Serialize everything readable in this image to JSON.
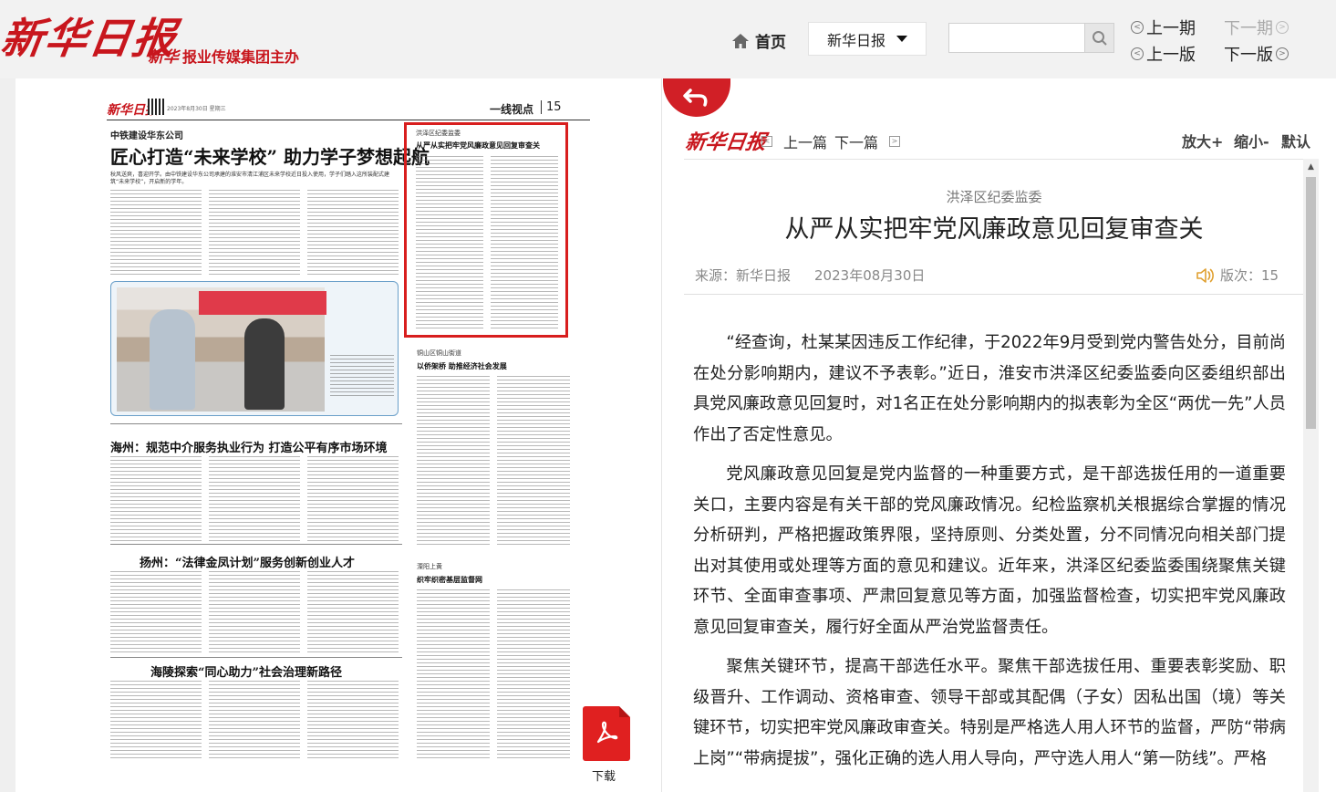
{
  "header": {
    "logo": "新华日报",
    "host_mark": "新华",
    "host_text": "报业传媒集团主办",
    "home": "首页",
    "paper_select": "新华日报",
    "search": {
      "value": "",
      "placeholder": ""
    },
    "prev_issue": "上一期",
    "next_issue": "下一期",
    "prev_page": "上一版",
    "next_page": "下一版"
  },
  "newspaper": {
    "logo": "新华日报",
    "date": "2023年8月30日  星期三",
    "section": "一线视点",
    "page_number": "15",
    "lead_kicker": "中铁建设华东公司",
    "lead_headline": "匠心打造“未来学校” 助力学子梦想起航",
    "lead_sub": "秋风送爽，喜迎开学。由中铁建设华东公司承建的淮安市清江浦区未来学校近日投入使用，学子们踏入这所装配式建筑“未来学校”，开启新的学年。",
    "boxed_kicker": "洪泽区纪委监委",
    "boxed_title": "从严从实把牢党风廉政意见回复审查关",
    "story2_kicker": "铜山区铜山街道",
    "story2_title": "以侨架桥 助推经济社会发展",
    "story3_title": "海州：规范中介服务执业行为 打造公平有序市场环境",
    "story4_kicker": "溧阳上黄",
    "story4_title": "织牢织密基层监督网",
    "story5_title": "扬州：“法律金凤计划”服务创新创业人才",
    "story6_title": "海陵探索“同心助力”社会治理新路径",
    "download_label": "下载"
  },
  "article_nav": {
    "logo": "新华日报",
    "prev_article": "上一篇",
    "next_article": "下一篇",
    "zoom_in": "放大+",
    "zoom_out": "缩小-",
    "zoom_default": "默认"
  },
  "article": {
    "kicker": "洪泽区纪委监委",
    "title": "从严从实把牢党风廉政意见回复审查关",
    "source": "来源：新华日报",
    "date": "2023年08月30日",
    "page": "版次：15",
    "paragraphs": [
      "“经查询，杜某某因违反工作纪律，于2022年9月受到党内警告处分，目前尚在处分影响期内，建议不予表彰。”近日，淮安市洪泽区纪委监委向区委组织部出具党风廉政意见回复时，对1名正在处分影响期内的拟表彰为全区“两优一先”人员作出了否定性意见。",
      "党风廉政意见回复是党内监督的一种重要方式，是干部选拔任用的一道重要关口，主要内容是有关干部的党风廉政情况。纪检监察机关根据综合掌握的情况分析研判，严格把握政策界限，坚持原则、分类处置，分不同情况向相关部门提出对其使用或处理等方面的意见和建议。近年来，洪泽区纪委监委围绕聚焦关键环节、全面审查事项、严肃回复意见等方面，加强监督检查，切实把牢党风廉政意见回复审查关，履行好全面从严治党监督责任。",
      "聚焦关键环节，提高干部选任水平。聚焦干部选拔任用、重要表彰奖励、职级晋升、工作调动、资格审查、领导干部或其配偶（子女）因私出国（境）等关键环节，切实把牢党风廉政审查关。特别是严格选人用人环节的监督，严防“带病上岗”“带病提拔”，强化正确的选人用人导向，严守选人用人“第一防线”。严格"
    ]
  },
  "colors": {
    "brand_red": "#c8161d",
    "highlight_red": "#d81e1e",
    "text": "#222222"
  }
}
